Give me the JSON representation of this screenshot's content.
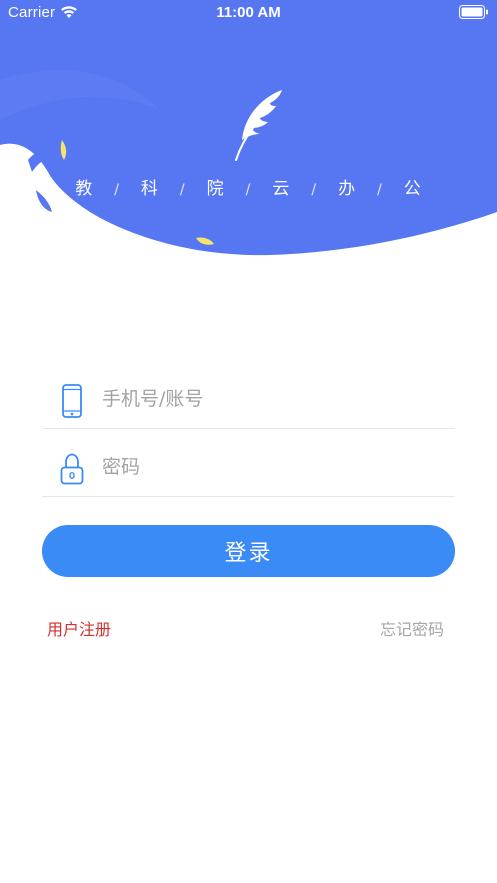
{
  "status_bar": {
    "carrier": "Carrier",
    "time": "11:00 AM"
  },
  "header": {
    "title_chars": [
      "教",
      "科",
      "院",
      "云",
      "办",
      "公"
    ],
    "separator": "/",
    "background_color": "#5676f2"
  },
  "form": {
    "account": {
      "placeholder": "手机号/账号",
      "value": "",
      "icon": "phone-icon"
    },
    "password": {
      "placeholder": "密码",
      "value": "",
      "icon": "lock-icon"
    },
    "login_label": "登录",
    "login_color": "#3a8bf5"
  },
  "links": {
    "register": "用户注册",
    "register_color": "#d2312f",
    "forgot": "忘记密码"
  }
}
